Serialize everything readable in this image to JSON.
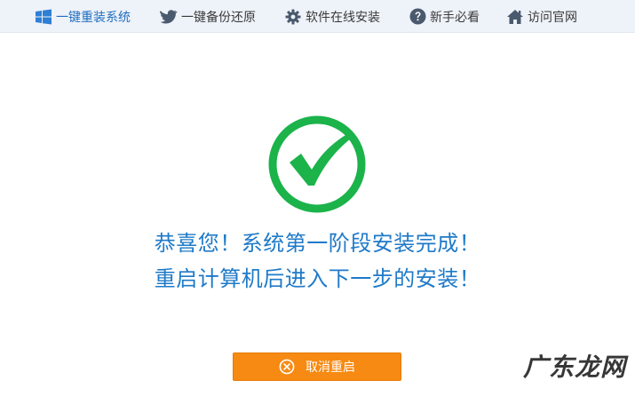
{
  "nav": {
    "items": [
      {
        "label": "一键重装系统",
        "icon": "windows-icon",
        "active": true
      },
      {
        "label": "一键备份还原",
        "icon": "bird-icon",
        "active": false
      },
      {
        "label": "软件在线安装",
        "icon": "gear-icon",
        "active": false
      },
      {
        "label": "新手必看",
        "icon": "help-icon",
        "active": false
      },
      {
        "label": "访问官网",
        "icon": "home-icon",
        "active": false
      }
    ]
  },
  "status": {
    "icon": "checkmark-circle-icon",
    "line1": "恭喜您！系统第一阶段安装完成！",
    "line2": "重启计算机后进入下一步的安装！"
  },
  "actions": {
    "cancel_label": "取消重启",
    "cancel_icon": "cancel-circle-icon"
  },
  "watermark": {
    "text": "广东龙网"
  },
  "colors": {
    "accent": "#1f7ac8",
    "success": "#1bb34a",
    "button": "#f78a12",
    "nav_bg": "#eef2f9"
  }
}
